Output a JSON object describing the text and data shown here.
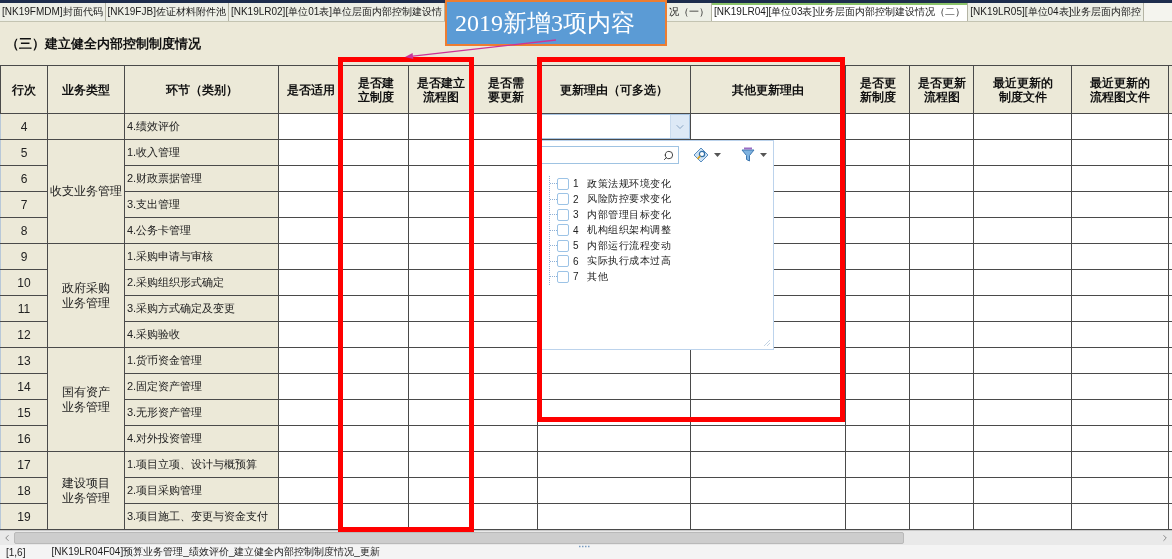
{
  "tabs": [
    {
      "label": "[NK19FMDM]封面代码",
      "selected": false
    },
    {
      "label": "[NK19FJB]佐证材料附件池",
      "selected": false
    },
    {
      "label": "[NK19LR02][单位01表]单位层面内部控制建设情",
      "selected": false
    },
    {
      "label": "况（一）",
      "selected": false
    },
    {
      "label": "[NK19LR04][单位03表]业务层面内部控制建设情况（二）",
      "selected": true
    },
    {
      "label": "[NK19LR05][单位04表]业务层面内部控",
      "selected": false
    }
  ],
  "callout": {
    "text": "2019新增3项内容"
  },
  "section_title": "（三）建立健全内部控制制度情况",
  "table": {
    "columns": [
      "行次",
      "业务类型",
      "环节（类别）",
      "是否适用",
      "是否建立制度",
      "是否建立流程图",
      "是否需要更新",
      "更新理由（可多选）",
      "其他更新理由",
      "是否更新制度",
      "是否更新流程图",
      "最近更新的制度文件",
      "最近更新的流程图文件"
    ],
    "groups": [
      {
        "rows": [
          {
            "number": "4",
            "item": "4.绩效评价",
            "reason_dropdown": {
              "expanded": true,
              "options": [
                {
                  "number": "1",
                  "label": "政策法规环境变化",
                  "checked": false
                },
                {
                  "number": "2",
                  "label": "风险防控要求变化",
                  "checked": false
                },
                {
                  "number": "3",
                  "label": "内部管理目标变化",
                  "checked": false
                },
                {
                  "number": "4",
                  "label": "机构组织架构调整",
                  "checked": false
                },
                {
                  "number": "5",
                  "label": "内部运行流程变动",
                  "checked": false
                },
                {
                  "number": "6",
                  "label": "实际执行成本过高",
                  "checked": false
                },
                {
                  "number": "7",
                  "label": "其他",
                  "checked": false
                }
              ]
            }
          }
        ]
      },
      {
        "category": "收支业务管理",
        "rows": [
          {
            "number": "5",
            "item": "1.收入管理"
          },
          {
            "number": "6",
            "item": "2.财政票据管理"
          },
          {
            "number": "7",
            "item": "3.支出管理"
          },
          {
            "number": "8",
            "item": "4.公务卡管理"
          }
        ]
      },
      {
        "category": "政府采购业务管理",
        "rows": [
          {
            "number": "9",
            "item": "1.采购申请与审核"
          },
          {
            "number": "10",
            "item": "2.采购组织形式确定"
          },
          {
            "number": "11",
            "item": "3.采购方式确定及变更"
          },
          {
            "number": "12",
            "item": "4.采购验收"
          }
        ]
      },
      {
        "category": "国有资产业务管理",
        "rows": [
          {
            "number": "13",
            "item": "1.货币资金管理"
          },
          {
            "number": "14",
            "item": "2.固定资产管理"
          },
          {
            "number": "15",
            "item": "3.无形资产管理"
          },
          {
            "number": "16",
            "item": "4.对外投资管理"
          }
        ]
      },
      {
        "category": "建设项目业务管理",
        "rows": [
          {
            "number": "17",
            "item": "1.项目立项、设计与概预算"
          },
          {
            "number": "18",
            "item": "2.项目采购管理"
          },
          {
            "number": "19",
            "item": "3.项目施工、变更与资金支付"
          }
        ]
      }
    ]
  },
  "status_bar": {
    "position": "[1,6]",
    "path": "[NK19LR04F04]预算业务管理_绩效评价_建立健全内部控制制度情况_更新"
  }
}
